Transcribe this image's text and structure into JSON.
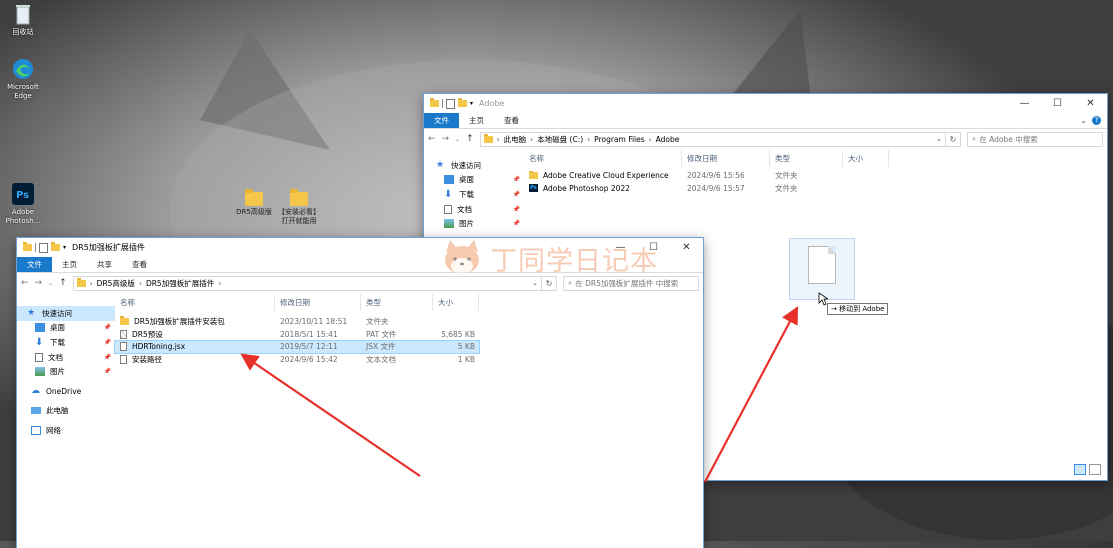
{
  "desktop": {
    "icons": [
      {
        "label": "回收站",
        "icon": "recycle-bin-icon"
      },
      {
        "label": "Microsoft Edge",
        "icon": "edge-icon"
      },
      {
        "label": "Adobe Photosh...",
        "icon": "photoshop-icon"
      },
      {
        "label": "DR5高级版",
        "icon": "folder-icon"
      },
      {
        "label": "【安装必看】打开就能用",
        "icon": "folder-icon"
      }
    ]
  },
  "colors": {
    "accent": "#1979ca",
    "selected": "#cce8ff",
    "arrow": "#e8302a"
  },
  "adobe_window": {
    "title": "Adobe",
    "tabs": [
      {
        "label": "文件"
      },
      {
        "label": "主页"
      },
      {
        "label": "查看"
      }
    ],
    "breadcrumb": [
      {
        "label": "此电脑"
      },
      {
        "label": "本地磁盘 (C:)"
      },
      {
        "label": "Program Files"
      },
      {
        "label": "Adobe"
      }
    ],
    "search_placeholder": "在 Adobe 中搜索",
    "nav": [
      {
        "label": "快速访问",
        "icon": "star-icon"
      },
      {
        "label": "桌面",
        "icon": "desktop-icon"
      },
      {
        "label": "下载",
        "icon": "download-icon"
      },
      {
        "label": "文档",
        "icon": "document-icon"
      },
      {
        "label": "图片",
        "icon": "picture-icon"
      }
    ],
    "columns": {
      "name": "名称",
      "date": "修改日期",
      "type": "类型",
      "size": "大小"
    },
    "files": [
      {
        "name": "Adobe Creative Cloud Experience",
        "date": "2024/9/6 15:56",
        "type": "文件夹",
        "size": "",
        "icon": "folder-icon"
      },
      {
        "name": "Adobe Photoshop 2022",
        "date": "2024/9/6 15:57",
        "type": "文件夹",
        "size": "",
        "icon": "photoshop-icon"
      }
    ]
  },
  "dr5_window": {
    "title": "DR5加强板扩展插件",
    "tabs": [
      {
        "label": "文件"
      },
      {
        "label": "主页"
      },
      {
        "label": "共享"
      },
      {
        "label": "查看"
      }
    ],
    "breadcrumb": [
      {
        "label": "DR5高级版"
      },
      {
        "label": "DR5加强板扩展插件"
      }
    ],
    "search_placeholder": "在 DR5加强板扩展插件 中搜索",
    "nav": [
      {
        "label": "快速访问",
        "icon": "star-icon"
      },
      {
        "label": "桌面",
        "icon": "desktop-icon"
      },
      {
        "label": "下载",
        "icon": "download-icon"
      },
      {
        "label": "文档",
        "icon": "document-icon"
      },
      {
        "label": "图片",
        "icon": "picture-icon"
      },
      {
        "label": "OneDrive",
        "icon": "cloud-icon"
      },
      {
        "label": "此电脑",
        "icon": "computer-icon"
      },
      {
        "label": "网络",
        "icon": "network-icon"
      }
    ],
    "columns": {
      "name": "名称",
      "date": "修改日期",
      "type": "类型",
      "size": "大小"
    },
    "files": [
      {
        "name": "DR5加强板扩展插件安装包",
        "date": "2023/10/11 18:51",
        "type": "文件夹",
        "size": "",
        "icon": "folder-icon"
      },
      {
        "name": "DR5预设",
        "date": "2018/5/1 15:41",
        "type": "PAT 文件",
        "size": "5,685 KB",
        "icon": "pat-file-icon"
      },
      {
        "name": "HDRToning.jsx",
        "date": "2019/5/7 12:11",
        "type": "JSX 文件",
        "size": "5 KB",
        "icon": "file-icon"
      },
      {
        "name": "安装路径",
        "date": "2024/9/6 15:42",
        "type": "文本文档",
        "size": "1 KB",
        "icon": "text-file-icon"
      }
    ]
  },
  "drag": {
    "tooltip": "→ 移动到 Adobe"
  },
  "watermark": {
    "text": "丁同学日记本"
  }
}
